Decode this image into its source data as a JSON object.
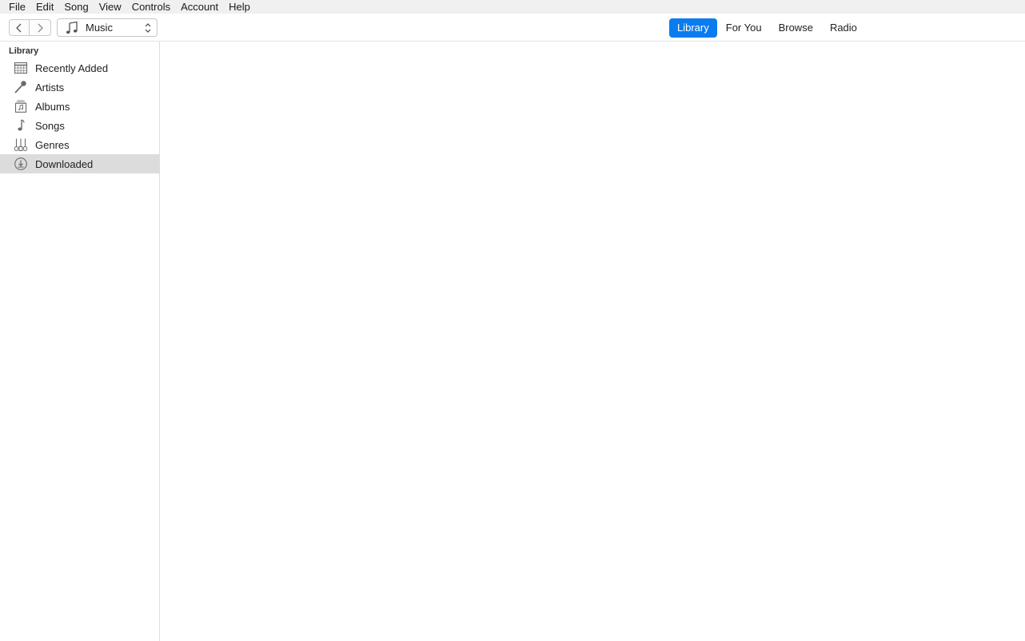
{
  "menubar": {
    "items": [
      "File",
      "Edit",
      "Song",
      "View",
      "Controls",
      "Account",
      "Help"
    ]
  },
  "toolbar": {
    "media_selector": {
      "value": "Music",
      "icon": "music-note-icon"
    },
    "tabs": [
      {
        "label": "Library",
        "active": true
      },
      {
        "label": "For You",
        "active": false
      },
      {
        "label": "Browse",
        "active": false
      },
      {
        "label": "Radio",
        "active": false
      }
    ],
    "accent_color": "#0a7cf0"
  },
  "sidebar": {
    "heading": "Library",
    "items": [
      {
        "label": "Recently Added",
        "icon": "recently-added-icon",
        "selected": false
      },
      {
        "label": "Artists",
        "icon": "microphone-icon",
        "selected": false
      },
      {
        "label": "Albums",
        "icon": "album-icon",
        "selected": false
      },
      {
        "label": "Songs",
        "icon": "music-note-icon",
        "selected": false
      },
      {
        "label": "Genres",
        "icon": "genres-icon",
        "selected": false
      },
      {
        "label": "Downloaded",
        "icon": "downloaded-icon",
        "selected": true
      }
    ],
    "selected_color": "#dcdcdc"
  }
}
